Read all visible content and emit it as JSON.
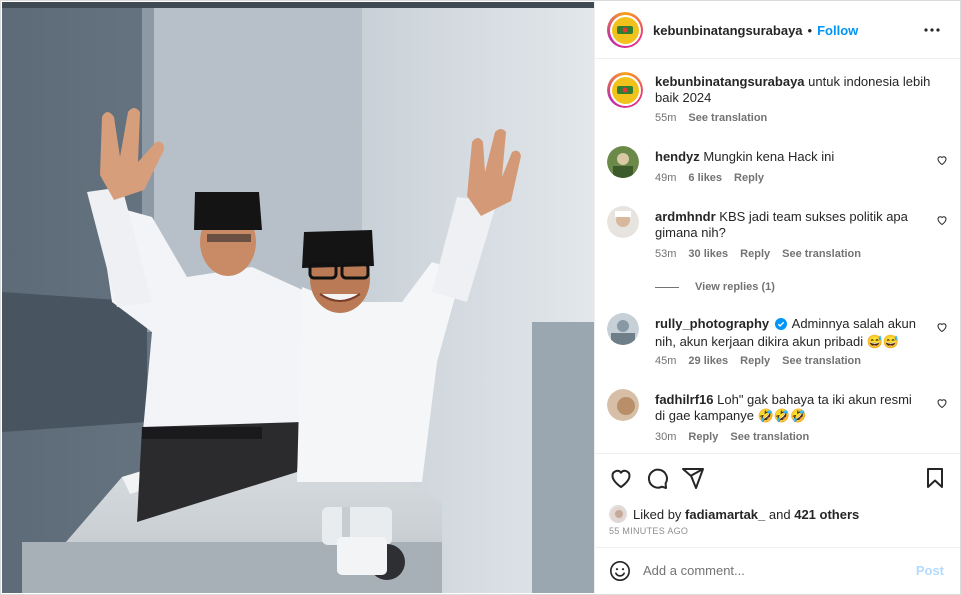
{
  "post": {
    "username": "kebunbinatangsurabaya",
    "follow_label": "Follow",
    "separator": "•",
    "caption": {
      "username": "kebunbinatangsurabaya",
      "text": "untuk indonesia lebih baik 2024",
      "time": "55m",
      "see_translation": "See translation"
    }
  },
  "comments": [
    {
      "username": "hendyz",
      "text": "Mungkin kena Hack ini",
      "verified": false,
      "time": "49m",
      "likes": "6 likes",
      "reply": "Reply",
      "translation": ""
    },
    {
      "username": "ardmhndr",
      "text": "KBS jadi team sukses politik apa gimana nih?",
      "verified": false,
      "time": "53m",
      "likes": "30 likes",
      "reply": "Reply",
      "translation": "See translation"
    },
    {
      "username": "rully_photography",
      "text": "Adminnya salah akun nih, akun kerjaan dikira akun pribadi 😅😅",
      "verified": true,
      "time": "45m",
      "likes": "29 likes",
      "reply": "Reply",
      "translation": "See translation"
    },
    {
      "username": "fadhilrf16",
      "text": "Loh\" gak bahaya ta iki akun resmi di gae kampanye 🤣🤣🤣",
      "verified": false,
      "time": "30m",
      "likes": "",
      "reply": "Reply",
      "translation": "See translation"
    }
  ],
  "view_replies": "View replies (1)",
  "likes": {
    "prefix": "Liked by",
    "user": "fadiamartak_",
    "and": "and",
    "others": "421 others",
    "ago": "55 MINUTES AGO"
  },
  "add_comment": {
    "placeholder": "Add a comment...",
    "post_label": "Post"
  },
  "icons": {
    "more": "more-options-icon",
    "heart": "heart-icon",
    "comment": "comment-icon",
    "share": "share-icon",
    "save": "bookmark-icon",
    "emoji": "emoji-icon",
    "verified": "verified-badge-icon"
  },
  "colors": {
    "follow": "#0095f6",
    "muted": "#737373",
    "post_disabled": "#b3dbff",
    "verified": "#0095f6"
  }
}
